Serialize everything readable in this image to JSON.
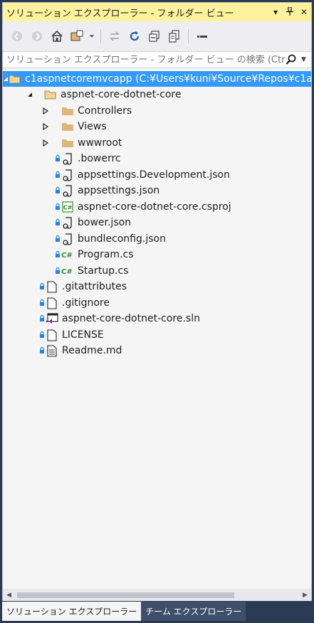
{
  "window": {
    "title": "ソリューション エクスプローラー - フォルダー ビュー",
    "dropdown_icon": "▾",
    "pin_icon": "⊥",
    "close_icon": "✕"
  },
  "toolbar": {
    "buttons": [
      "back-icon",
      "forward-icon",
      "home-icon",
      "switch-views-icon",
      "dropdown-icon",
      "sync-icon",
      "refresh-icon",
      "collapse-all-icon",
      "show-all-files-icon",
      "properties-icon"
    ]
  },
  "search": {
    "placeholder": "ソリューション エクスプローラー - フォルダー ビュー の検索 (Ctrl+;)"
  },
  "tree": {
    "items": [
      {
        "label": "c1aspnetcoremvcapp (C:¥Users¥kuni¥Source¥Repos¥c1a",
        "icon": "folder-open-icon"
      },
      {
        "label": "aspnet-core-dotnet-core",
        "icon": "folder-open-icon"
      },
      {
        "label": "Controllers",
        "icon": "folder-icon"
      },
      {
        "label": "Views",
        "icon": "folder-icon"
      },
      {
        "label": "wwwroot",
        "icon": "folder-icon"
      },
      {
        "label": ".bowerrc",
        "icon": "config-file-icon"
      },
      {
        "label": "appsettings.Development.json",
        "icon": "json-file-icon"
      },
      {
        "label": "appsettings.json",
        "icon": "json-file-icon"
      },
      {
        "label": "aspnet-core-dotnet-core.csproj",
        "icon": "csproj-file-icon"
      },
      {
        "label": "bower.json",
        "icon": "json-file-icon"
      },
      {
        "label": "bundleconfig.json",
        "icon": "json-file-icon"
      },
      {
        "label": "Program.cs",
        "icon": "csharp-file-icon"
      },
      {
        "label": "Startup.cs",
        "icon": "csharp-file-icon"
      },
      {
        "label": ".gitattributes",
        "icon": "file-icon"
      },
      {
        "label": ".gitignore",
        "icon": "file-icon"
      },
      {
        "label": "aspnet-core-dotnet-core.sln",
        "icon": "solution-file-icon"
      },
      {
        "label": "LICENSE",
        "icon": "file-icon"
      },
      {
        "label": "Readme.md",
        "icon": "text-file-icon"
      }
    ]
  },
  "tabs": [
    {
      "label": "ソリューション エクスプローラー"
    },
    {
      "label": "チーム エクスプローラー"
    }
  ],
  "colors": {
    "title_bar": "#fff29d",
    "selection": "#3399ff",
    "csharp_icon": "#388a34",
    "folder": "#dcb67a"
  }
}
